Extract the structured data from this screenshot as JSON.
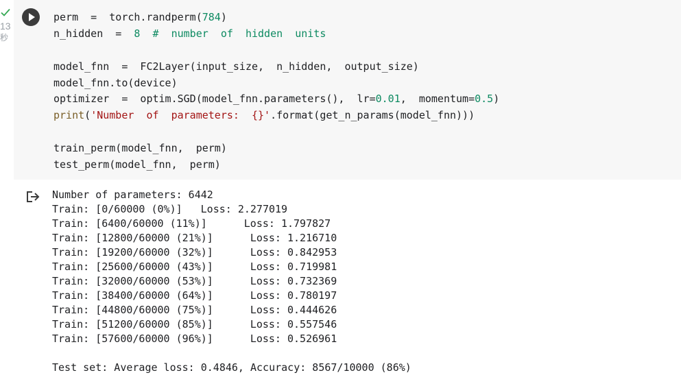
{
  "cell": {
    "execution_count": "13",
    "execution_time_unit": "秒",
    "status": "success",
    "code_lines": [
      [
        {
          "t": "perm  =  torch.randperm(",
          "c": ""
        },
        {
          "t": "784",
          "c": "num"
        },
        {
          "t": ")",
          "c": ""
        }
      ],
      [
        {
          "t": "n_hidden  =  ",
          "c": ""
        },
        {
          "t": "8",
          "c": "num"
        },
        {
          "t": "  ",
          "c": ""
        },
        {
          "t": "#  number  of  hidden  units",
          "c": "comment"
        }
      ],
      [],
      [
        {
          "t": "model_fnn  =  FC2Layer(input_size,  n_hidden,  output_size)",
          "c": ""
        }
      ],
      [
        {
          "t": "model_fnn.to(device)",
          "c": ""
        }
      ],
      [
        {
          "t": "optimizer  =  optim.SGD(model_fnn.parameters(),  lr=",
          "c": ""
        },
        {
          "t": "0.01",
          "c": "num"
        },
        {
          "t": ",  momentum=",
          "c": ""
        },
        {
          "t": "0.5",
          "c": "num"
        },
        {
          "t": ")",
          "c": ""
        }
      ],
      [
        {
          "t": "print",
          "c": "builtin"
        },
        {
          "t": "(",
          "c": ""
        },
        {
          "t": "'Number  of  parameters:  {}'",
          "c": "str"
        },
        {
          "t": ".format(get_n_params(model_fnn)))",
          "c": ""
        }
      ],
      [],
      [
        {
          "t": "train_perm(model_fnn,  perm)",
          "c": ""
        }
      ],
      [
        {
          "t": "test_perm(model_fnn,  perm)",
          "c": ""
        }
      ]
    ]
  },
  "output": {
    "params_line": "Number of parameters: 6442",
    "train_rows": [
      {
        "progress": "Train: [0/60000 (0%)]",
        "loss": "Loss: 2.277019",
        "tab": "a"
      },
      {
        "progress": "Train: [6400/60000 (11%)]",
        "loss": "Loss: 1.797827",
        "tab": "b"
      },
      {
        "progress": "Train: [12800/60000 (21%)]",
        "loss": "Loss: 1.216710",
        "tab": "b"
      },
      {
        "progress": "Train: [19200/60000 (32%)]",
        "loss": "Loss: 0.842953",
        "tab": "b"
      },
      {
        "progress": "Train: [25600/60000 (43%)]",
        "loss": "Loss: 0.719981",
        "tab": "b"
      },
      {
        "progress": "Train: [32000/60000 (53%)]",
        "loss": "Loss: 0.732369",
        "tab": "b"
      },
      {
        "progress": "Train: [38400/60000 (64%)]",
        "loss": "Loss: 0.780197",
        "tab": "b"
      },
      {
        "progress": "Train: [44800/60000 (75%)]",
        "loss": "Loss: 0.444626",
        "tab": "b"
      },
      {
        "progress": "Train: [51200/60000 (85%)]",
        "loss": "Loss: 0.557546",
        "tab": "b"
      },
      {
        "progress": "Train: [57600/60000 (96%)]",
        "loss": "Loss: 0.526961",
        "tab": "b"
      }
    ],
    "test_line": "Test set: Average loss: 0.4846, Accuracy: 8567/10000 (86%)"
  },
  "colors": {
    "cell_background": "#f7f7f7",
    "success_check": "#34a853",
    "number": "#0d8a61",
    "string": "#a31515",
    "run_button": "#3c3c3c"
  },
  "icons": {
    "status": "check-icon",
    "run": "play-icon",
    "output": "output-arrow-icon"
  }
}
